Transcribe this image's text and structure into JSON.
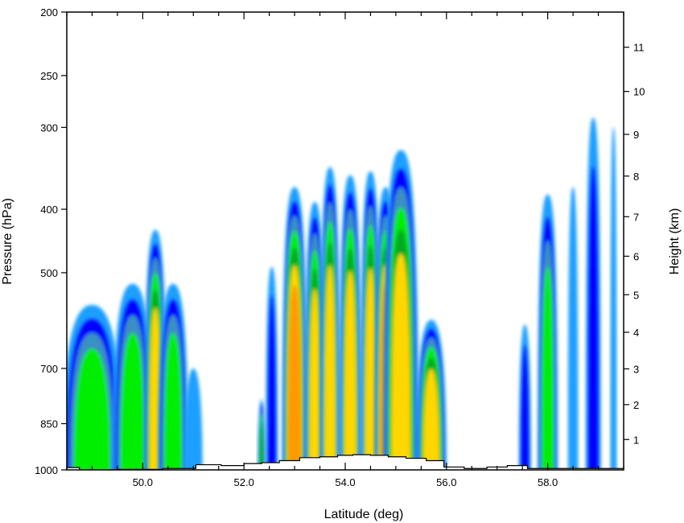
{
  "chart_data": {
    "type": "heatmap",
    "title": "",
    "xlabel": "Latitude (deg)",
    "ylabel": "Pressure (hPa)",
    "y2label": "Height (km)",
    "xlim": [
      48.5,
      59.5
    ],
    "ylim_pressure": [
      1000,
      200
    ],
    "y_scale": "log",
    "x_ticks": [
      50.0,
      52.0,
      54.0,
      56.0,
      58.0
    ],
    "x_tick_labels": [
      "50.0",
      "52.0",
      "54.0",
      "56.0",
      "58.0"
    ],
    "pressure_ticks": [
      1000,
      850,
      700,
      500,
      400,
      300,
      250,
      200
    ],
    "pressure_tick_labels": [
      "1000",
      "850",
      "700",
      "500",
      "400",
      "300",
      "250",
      "200"
    ],
    "height_ticks": [
      1,
      2,
      3,
      4,
      5,
      6,
      7,
      8,
      9,
      10,
      11
    ],
    "height_tick_labels": [
      "1",
      "2",
      "3",
      "4",
      "5",
      "6",
      "7",
      "8",
      "9",
      "10",
      "11"
    ],
    "grid": false,
    "legend": "none",
    "colors": {
      "level1": "#1e9fff",
      "level2": "#0000ff",
      "level3": "#3a8fc4",
      "level4": "#00ee00",
      "level5": "#00aa22",
      "level6": "#ffd700",
      "level7": "#ff9900",
      "terrain_line": "#000000"
    },
    "cloud_cells": [
      {
        "lat": 49.0,
        "half_width": 0.6,
        "top_hpa": 560,
        "core": "level4"
      },
      {
        "lat": 49.8,
        "half_width": 0.4,
        "top_hpa": 520,
        "core": "level4"
      },
      {
        "lat": 50.25,
        "half_width": 0.22,
        "top_hpa": 430,
        "core": "level6"
      },
      {
        "lat": 50.6,
        "half_width": 0.3,
        "top_hpa": 520,
        "core": "level4"
      },
      {
        "lat": 51.0,
        "half_width": 0.18,
        "top_hpa": 700,
        "core": "level1"
      },
      {
        "lat": 52.35,
        "half_width": 0.08,
        "top_hpa": 780,
        "core": "level5"
      },
      {
        "lat": 52.55,
        "half_width": 0.12,
        "top_hpa": 490,
        "core": "level2"
      },
      {
        "lat": 53.0,
        "half_width": 0.25,
        "top_hpa": 370,
        "core": "level7"
      },
      {
        "lat": 53.4,
        "half_width": 0.2,
        "top_hpa": 390,
        "core": "level6"
      },
      {
        "lat": 53.7,
        "half_width": 0.2,
        "top_hpa": 345,
        "core": "level6"
      },
      {
        "lat": 54.1,
        "half_width": 0.22,
        "top_hpa": 355,
        "core": "level6"
      },
      {
        "lat": 54.5,
        "half_width": 0.2,
        "top_hpa": 350,
        "core": "level6"
      },
      {
        "lat": 54.8,
        "half_width": 0.22,
        "top_hpa": 370,
        "core": "level7"
      },
      {
        "lat": 55.1,
        "half_width": 0.35,
        "top_hpa": 325,
        "core": "level6"
      },
      {
        "lat": 55.7,
        "half_width": 0.3,
        "top_hpa": 590,
        "core": "level6"
      },
      {
        "lat": 57.55,
        "half_width": 0.12,
        "top_hpa": 600,
        "core": "level2"
      },
      {
        "lat": 58.0,
        "half_width": 0.2,
        "top_hpa": 380,
        "core": "level4"
      },
      {
        "lat": 58.5,
        "half_width": 0.1,
        "top_hpa": 370,
        "core": "level1"
      },
      {
        "lat": 58.9,
        "half_width": 0.15,
        "top_hpa": 290,
        "core": "level2"
      },
      {
        "lat": 59.3,
        "half_width": 0.06,
        "top_hpa": 300,
        "core": "level1"
      }
    ],
    "terrain_hpa": [
      [
        48.5,
        992
      ],
      [
        49.0,
        1000
      ],
      [
        50.0,
        998
      ],
      [
        50.8,
        995
      ],
      [
        51.3,
        982
      ],
      [
        51.8,
        985
      ],
      [
        52.2,
        978
      ],
      [
        52.5,
        975
      ],
      [
        52.9,
        968
      ],
      [
        53.3,
        958
      ],
      [
        53.7,
        955
      ],
      [
        54.0,
        950
      ],
      [
        54.3,
        948
      ],
      [
        54.7,
        950
      ],
      [
        55.0,
        955
      ],
      [
        55.4,
        960
      ],
      [
        55.8,
        968
      ],
      [
        56.1,
        990
      ],
      [
        56.6,
        995
      ],
      [
        57.0,
        990
      ],
      [
        57.4,
        985
      ],
      [
        57.8,
        995
      ],
      [
        58.5,
        995
      ],
      [
        59.5,
        995
      ]
    ]
  }
}
